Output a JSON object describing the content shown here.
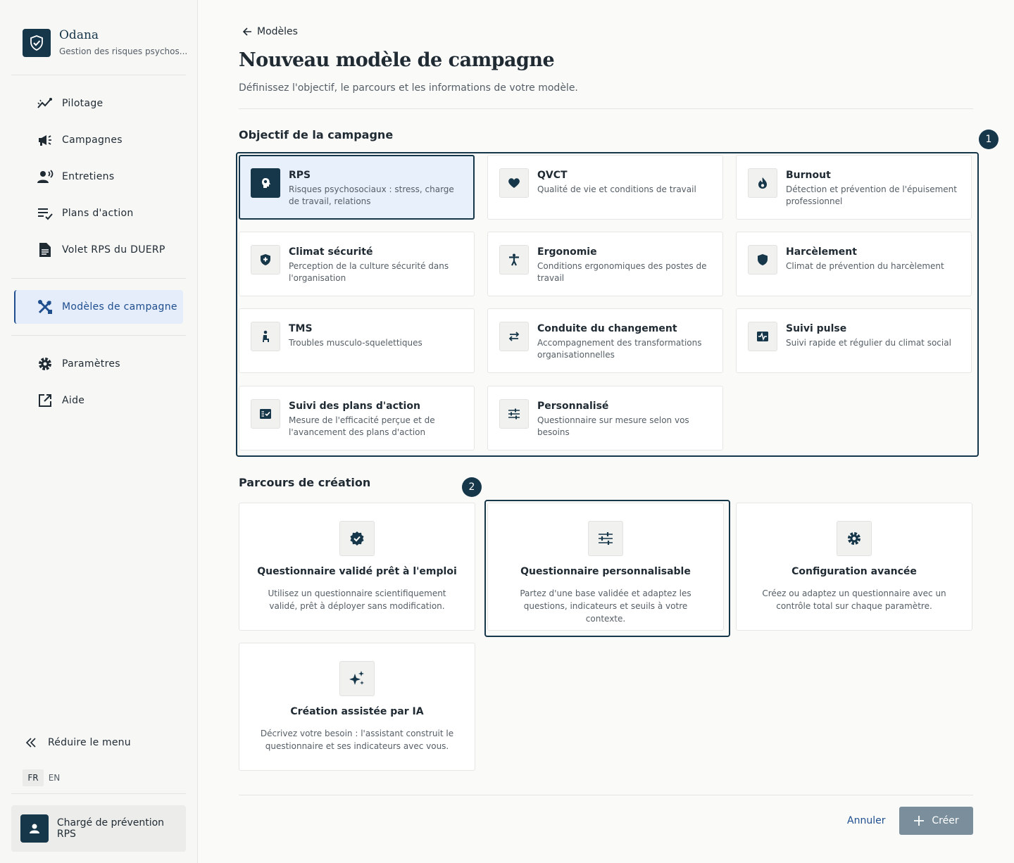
{
  "brand": {
    "name": "Odana",
    "subtitle": "Gestion des risques psychos..."
  },
  "sidebar": {
    "items": [
      {
        "label": "Pilotage",
        "icon": "chart-line-icon"
      },
      {
        "label": "Campagnes",
        "icon": "megaphone-icon"
      },
      {
        "label": "Entretiens",
        "icon": "person-voice-icon"
      },
      {
        "label": "Plans d'action",
        "icon": "checklist-icon"
      },
      {
        "label": "Volet RPS du DUERP",
        "icon": "document-icon"
      },
      {
        "label": "Modèles de campagne",
        "icon": "tools-icon",
        "active": true
      },
      {
        "label": "Paramètres",
        "icon": "gear-icon"
      },
      {
        "label": "Aide",
        "icon": "external-link-icon"
      }
    ],
    "collapse_label": "Réduire le menu",
    "languages": [
      "FR",
      "EN"
    ],
    "active_language": "FR",
    "user_label": "Chargé de prévention RPS"
  },
  "header": {
    "back_label": "Modèles",
    "title": "Nouveau modèle de campagne",
    "subtitle": "Définissez l'objectif, le parcours et les informations de votre modèle."
  },
  "objectives": {
    "title": "Objectif de la campagne",
    "step": "1",
    "items": [
      {
        "title": "RPS",
        "desc": "Risques psychosociaux : stress, charge de travail, relations",
        "icon": "brain-head-icon",
        "selected": true
      },
      {
        "title": "QVCT",
        "desc": "Qualité de vie et conditions de travail",
        "icon": "heart-icon"
      },
      {
        "title": "Burnout",
        "desc": "Détection et prévention de l'épuisement professionnel",
        "icon": "flame-icon"
      },
      {
        "title": "Climat sécurité",
        "desc": "Perception de la culture sécurité dans l'organisation",
        "icon": "shield-plus-icon"
      },
      {
        "title": "Ergonomie",
        "desc": "Conditions ergonomiques des postes de travail",
        "icon": "accessibility-icon"
      },
      {
        "title": "Harcèlement",
        "desc": "Climat de prévention du harcèlement",
        "icon": "shield-icon"
      },
      {
        "title": "TMS",
        "desc": "Troubles musculo-squelettiques",
        "icon": "seated-person-icon"
      },
      {
        "title": "Conduite du changement",
        "desc": "Accompagnement des transformations organisationnelles",
        "icon": "swap-arrows-icon"
      },
      {
        "title": "Suivi pulse",
        "desc": "Suivi rapide et régulier du climat social",
        "icon": "pulse-icon"
      },
      {
        "title": "Suivi des plans d'action",
        "desc": "Mesure de l'efficacité perçue et de l'avancement des plans d'action",
        "icon": "task-checklist-icon"
      },
      {
        "title": "Personnalisé",
        "desc": "Questionnaire sur mesure selon vos besoins",
        "icon": "sliders-icon"
      }
    ]
  },
  "paths": {
    "title": "Parcours de création",
    "step": "2",
    "items": [
      {
        "title": "Questionnaire validé prêt à l'emploi",
        "desc": "Utilisez un questionnaire scientifiquement validé, prêt à déployer sans modification.",
        "icon": "verified-badge-icon"
      },
      {
        "title": "Questionnaire personnalisable",
        "desc": "Partez d'une base validée et adaptez les questions, indicateurs et seuils à votre contexte.",
        "icon": "sliders-icon"
      },
      {
        "title": "Configuration avancée",
        "desc": "Créez ou adaptez un questionnaire avec un contrôle total sur chaque paramètre.",
        "icon": "gear-icon"
      },
      {
        "title": "Création assistée par IA",
        "desc": "Décrivez votre besoin : l'assistant construit le questionnaire et ses indicateurs avec vous.",
        "icon": "sparkles-icon"
      }
    ]
  },
  "footer": {
    "cancel_label": "Annuler",
    "create_label": "Créer"
  },
  "colors": {
    "primary": "#163649",
    "accent": "#1f4e8f",
    "selected_bg": "#e8f0fc",
    "disabled_button": "#7a8e9c"
  }
}
